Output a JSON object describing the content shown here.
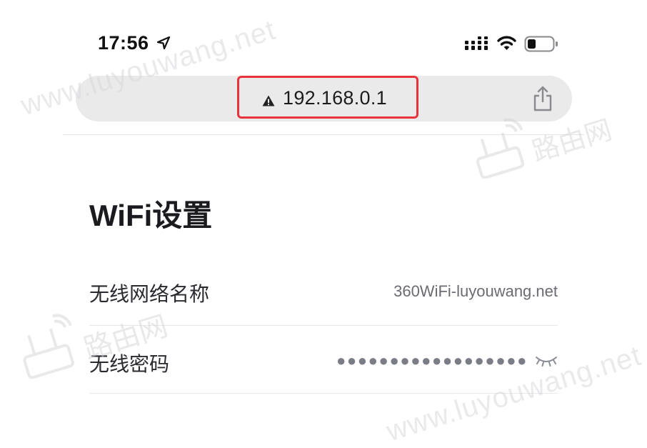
{
  "status_bar": {
    "time": "17:56",
    "icons": [
      "location-arrow-icon",
      "cellular-signal-icon",
      "wifi-icon",
      "battery-icon"
    ]
  },
  "address_bar": {
    "url": "192.168.0.1",
    "warning_icon": "warning-triangle-icon",
    "share_icon": "share-icon",
    "highlight_color": "#e8323c"
  },
  "page": {
    "title": "WiFi设置"
  },
  "settings": {
    "ssid": {
      "label": "无线网络名称",
      "value": "360WiFi-luyouwang.net"
    },
    "password": {
      "label": "无线密码",
      "value": "●●●●●●●●●●●●●●●●●●",
      "toggle_icon": "eye-closed-icon"
    }
  },
  "watermarks": {
    "text": "www.luyouwang.net",
    "logo_text": "路由网"
  }
}
